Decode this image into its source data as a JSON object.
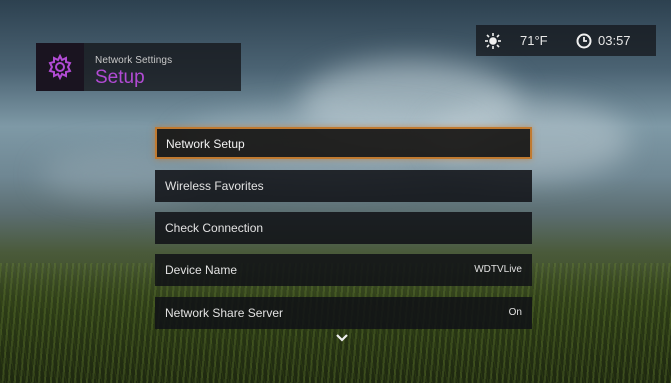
{
  "header": {
    "section": "Network Settings",
    "title": "Setup",
    "icon": "gear-icon",
    "accent_color": "#b24bd4"
  },
  "status": {
    "weather_icon": "sun-icon",
    "temperature": "71°F",
    "clock_icon": "clock-icon",
    "time": "03:57"
  },
  "menu": {
    "items": [
      {
        "label": "Network Setup",
        "value": "",
        "selected": true
      },
      {
        "label": "Wireless Favorites",
        "value": ""
      },
      {
        "label": "Check Connection",
        "value": ""
      },
      {
        "label": "Device Name",
        "value": "WDTVLive"
      },
      {
        "label": "Network Share Server",
        "value": "On"
      }
    ],
    "selection_color": "#c07a30",
    "more_icon": "chevron-down-icon"
  }
}
